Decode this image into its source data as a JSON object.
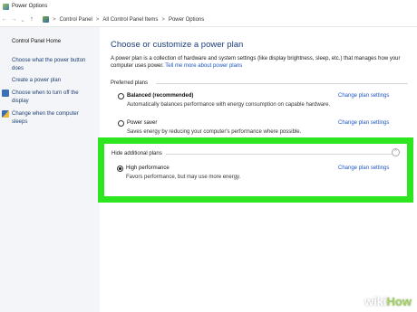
{
  "window": {
    "title": "Power Options"
  },
  "address": {
    "breadcrumb": [
      "Control Panel",
      "All Control Panel Items",
      "Power Options"
    ],
    "separator": ">"
  },
  "sidebar": {
    "home": "Control Panel Home",
    "links": [
      "Choose what the power button does",
      "Create a power plan",
      "Choose when to turn off the display",
      "Change when the computer sleeps"
    ]
  },
  "main": {
    "heading": "Choose or customize a power plan",
    "intro_text": "A power plan is a collection of hardware and system settings (like display brightness, sleep, etc.) that manages how your computer uses power.",
    "intro_link": "Tell me more about power plans",
    "preferred_label": "Preferred plans",
    "hide_additional_label": "Hide additional plans",
    "change_label": "Change plan settings",
    "plans": [
      {
        "name": "Balanced (recommended)",
        "description": "Automatically balances performance with energy consumption on capable hardware.",
        "selected": false
      },
      {
        "name": "Power saver",
        "description": "Saves energy by reducing your computer's performance where possible.",
        "selected": false
      },
      {
        "name": "High performance",
        "description": "Favors performance, but may use more energy.",
        "selected": true
      }
    ]
  },
  "highlight": {
    "color": "#2ee61f"
  },
  "watermark": {
    "part1": "wiki",
    "part2": "How"
  },
  "icons": {
    "back": "arrow-left-icon",
    "forward": "arrow-right-icon",
    "recent": "chevron-down-icon",
    "up": "arrow-up-icon",
    "collapse": "chevron-up-icon"
  }
}
